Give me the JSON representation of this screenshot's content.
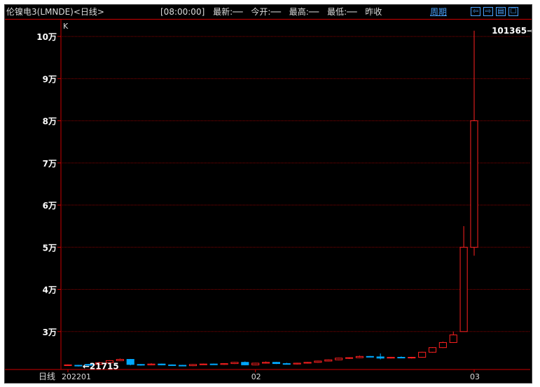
{
  "header": {
    "title": "伦镍电3(LMNDE)<日线>",
    "time": "[08:00:00]",
    "latest": "最新:──",
    "open": "今开:──",
    "high": "最高:──",
    "low": "最低:──",
    "prev": "昨收",
    "period_link": "周期",
    "buttons": [
      "⇦",
      "⇨",
      "▤",
      "☐"
    ]
  },
  "footer": {
    "period_label": "日线"
  },
  "colors": {
    "up": "#ff2020",
    "down": "#00a8ff",
    "grid": "#8b0000",
    "axis": "#cc0000",
    "label": "#ffffff"
  },
  "chart_data": {
    "type": "candlestick",
    "indicator_label": "K",
    "ylim": [
      21000,
      104000
    ],
    "yticks": [
      30000,
      40000,
      50000,
      60000,
      70000,
      80000,
      90000,
      100000
    ],
    "ytick_labels": [
      "3万",
      "4万",
      "5万",
      "6万",
      "7万",
      "8万",
      "9万",
      "10万"
    ],
    "xtick_labels": [
      {
        "label": "202201",
        "index": 0
      },
      {
        "label": "02",
        "index": 18
      },
      {
        "label": "03",
        "index": 39
      }
    ],
    "annotations": [
      {
        "text": "101365",
        "value": 101365,
        "direction": "right",
        "index": 45
      },
      {
        "text": "21715",
        "value": 21715,
        "direction": "left",
        "index": 1
      }
    ],
    "candles": [
      {
        "o": 22100,
        "h": 22200,
        "l": 21900,
        "c": 22000,
        "dir": "up"
      },
      {
        "o": 22000,
        "h": 22100,
        "l": 21715,
        "c": 21900,
        "dir": "down"
      },
      {
        "o": 22000,
        "h": 22300,
        "l": 21900,
        "c": 22200,
        "dir": "down"
      },
      {
        "o": 22200,
        "h": 22800,
        "l": 22100,
        "c": 22600,
        "dir": "up"
      },
      {
        "o": 22600,
        "h": 23200,
        "l": 22500,
        "c": 23100,
        "dir": "up"
      },
      {
        "o": 23100,
        "h": 23600,
        "l": 23000,
        "c": 23400,
        "dir": "up"
      },
      {
        "o": 23400,
        "h": 23500,
        "l": 22000,
        "c": 22200,
        "dir": "down"
      },
      {
        "o": 22200,
        "h": 22300,
        "l": 21900,
        "c": 22100,
        "dir": "down"
      },
      {
        "o": 22100,
        "h": 22500,
        "l": 22000,
        "c": 22300,
        "dir": "up"
      },
      {
        "o": 22300,
        "h": 22400,
        "l": 22000,
        "c": 22100,
        "dir": "down"
      },
      {
        "o": 22100,
        "h": 22200,
        "l": 21900,
        "c": 22000,
        "dir": "down"
      },
      {
        "o": 22000,
        "h": 22100,
        "l": 21800,
        "c": 21900,
        "dir": "down"
      },
      {
        "o": 21900,
        "h": 22300,
        "l": 21800,
        "c": 22200,
        "dir": "up"
      },
      {
        "o": 22200,
        "h": 22400,
        "l": 22100,
        "c": 22300,
        "dir": "up"
      },
      {
        "o": 22300,
        "h": 22400,
        "l": 22100,
        "c": 22200,
        "dir": "down"
      },
      {
        "o": 22200,
        "h": 22500,
        "l": 22100,
        "c": 22400,
        "dir": "up"
      },
      {
        "o": 22400,
        "h": 22800,
        "l": 22300,
        "c": 22700,
        "dir": "up"
      },
      {
        "o": 22700,
        "h": 22900,
        "l": 22000,
        "c": 22100,
        "dir": "down"
      },
      {
        "o": 22100,
        "h": 22600,
        "l": 22000,
        "c": 22500,
        "dir": "up"
      },
      {
        "o": 22500,
        "h": 22900,
        "l": 22400,
        "c": 22700,
        "dir": "up"
      },
      {
        "o": 22700,
        "h": 22800,
        "l": 22300,
        "c": 22400,
        "dir": "down"
      },
      {
        "o": 22400,
        "h": 22600,
        "l": 22200,
        "c": 22300,
        "dir": "down"
      },
      {
        "o": 22300,
        "h": 22600,
        "l": 22200,
        "c": 22500,
        "dir": "up"
      },
      {
        "o": 22500,
        "h": 22800,
        "l": 22400,
        "c": 22700,
        "dir": "up"
      },
      {
        "o": 22700,
        "h": 23100,
        "l": 22600,
        "c": 23000,
        "dir": "up"
      },
      {
        "o": 23000,
        "h": 23400,
        "l": 22900,
        "c": 23300,
        "dir": "up"
      },
      {
        "o": 23300,
        "h": 23800,
        "l": 23200,
        "c": 23700,
        "dir": "up"
      },
      {
        "o": 23700,
        "h": 23900,
        "l": 23500,
        "c": 23800,
        "dir": "up"
      },
      {
        "o": 23800,
        "h": 24300,
        "l": 23700,
        "c": 24100,
        "dir": "up"
      },
      {
        "o": 24100,
        "h": 24200,
        "l": 23900,
        "c": 24000,
        "dir": "down"
      },
      {
        "o": 24000,
        "h": 24800,
        "l": 23400,
        "c": 23700,
        "dir": "down"
      },
      {
        "o": 23700,
        "h": 24000,
        "l": 23600,
        "c": 23900,
        "dir": "up"
      },
      {
        "o": 23900,
        "h": 24100,
        "l": 23700,
        "c": 23800,
        "dir": "down"
      },
      {
        "o": 23800,
        "h": 24000,
        "l": 23600,
        "c": 23900,
        "dir": "up"
      },
      {
        "o": 23900,
        "h": 25200,
        "l": 23800,
        "c": 25100,
        "dir": "up"
      },
      {
        "o": 25100,
        "h": 26300,
        "l": 25000,
        "c": 26200,
        "dir": "up"
      },
      {
        "o": 26200,
        "h": 27600,
        "l": 26100,
        "c": 27400,
        "dir": "up"
      },
      {
        "o": 27400,
        "h": 30000,
        "l": 27300,
        "c": 29200,
        "dir": "up"
      },
      {
        "o": 30000,
        "h": 55000,
        "l": 30000,
        "c": 50000,
        "dir": "up"
      },
      {
        "o": 50000,
        "h": 101365,
        "l": 48000,
        "c": 80000,
        "dir": "up"
      }
    ]
  }
}
